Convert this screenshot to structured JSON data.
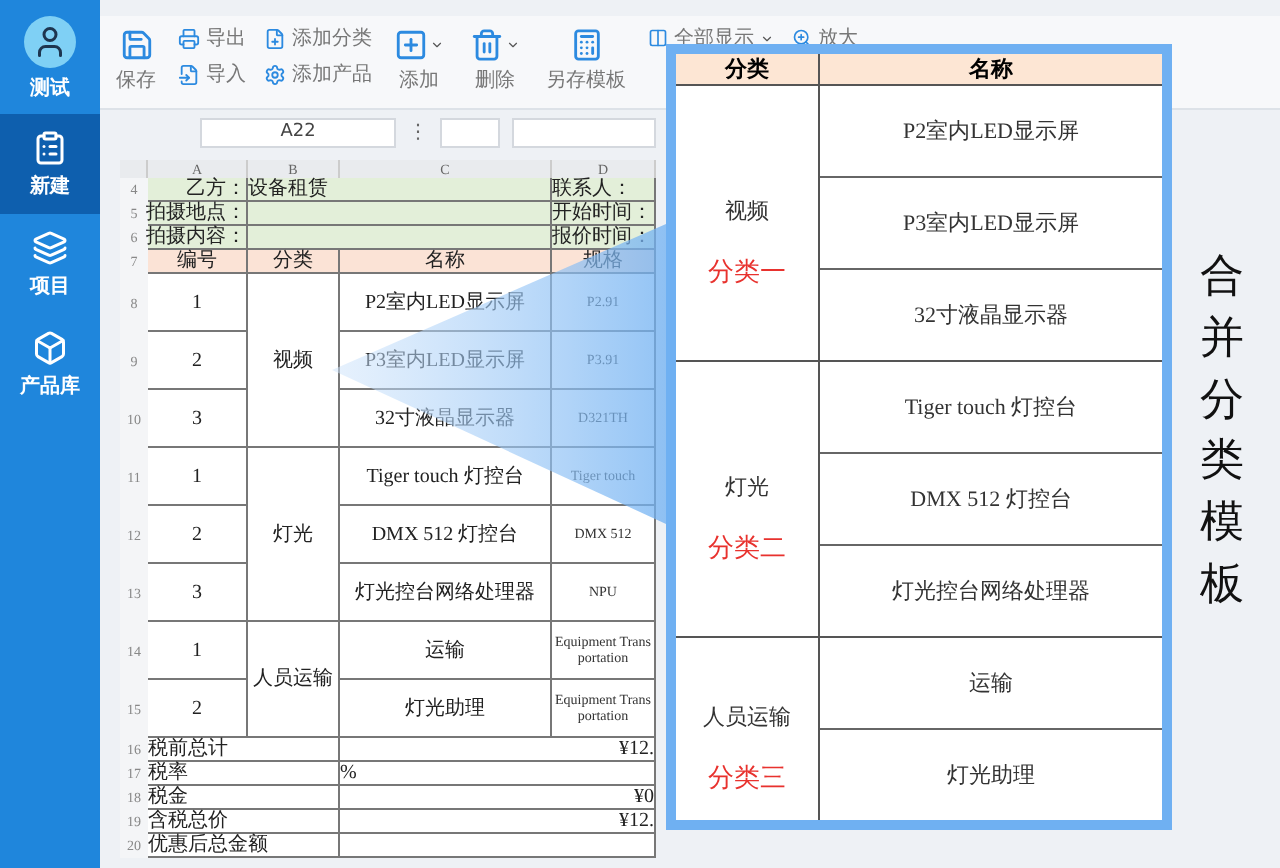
{
  "sidebar": {
    "user": "测试",
    "items": [
      {
        "label": "新建",
        "selected": true
      },
      {
        "label": "项目",
        "selected": false
      },
      {
        "label": "产品库",
        "selected": false
      }
    ]
  },
  "toolbar": [
    {
      "kind": "large",
      "label": "保存"
    },
    {
      "kind": "pair",
      "labels": [
        "导出",
        "导入"
      ]
    },
    {
      "kind": "pair",
      "labels": [
        "添加分类",
        "添加产品"
      ]
    },
    {
      "kind": "dropdown",
      "label": "添加"
    },
    {
      "kind": "dropdown",
      "label": "删除"
    },
    {
      "kind": "large",
      "label": "另存模板"
    },
    {
      "kind": "select",
      "label": "全部显示"
    },
    {
      "kind": "small",
      "label": "放大"
    }
  ],
  "formula_bar": {
    "cell_ref": "A22",
    "separator": "⋮"
  },
  "sheet": {
    "columns": [
      "A",
      "B",
      "C",
      "D"
    ],
    "info_rows": [
      {
        "row": "4",
        "label": "乙方：",
        "value": "设备租赁",
        "label_2": "联系人："
      },
      {
        "row": "5",
        "label": "拍摄地点：",
        "label_2": "开始时间："
      },
      {
        "row": "6",
        "label": "拍摄内容：",
        "label_2": "报价时间："
      }
    ],
    "header": {
      "row": "7",
      "cells": [
        "编号",
        "分类",
        "名称",
        "规格"
      ]
    },
    "groups": [
      {
        "category": "视频",
        "items": [
          {
            "row": "8",
            "no": "1",
            "name": "P2室内LED显示屏",
            "spec": "P2.91"
          },
          {
            "row": "9",
            "no": "2",
            "name": "P3室内LED显示屏",
            "spec": "P3.91"
          },
          {
            "row": "10",
            "no": "3",
            "name": "32寸液晶显示器",
            "spec": "D321TH"
          }
        ]
      },
      {
        "category": "灯光",
        "items": [
          {
            "row": "11",
            "no": "1",
            "name": "Tiger touch 灯控台",
            "spec": "Tiger touch"
          },
          {
            "row": "12",
            "no": "2",
            "name": "DMX 512 灯控台",
            "spec": "DMX 512"
          },
          {
            "row": "13",
            "no": "3",
            "name": "灯光控台网络处理器",
            "spec": "NPU"
          }
        ]
      },
      {
        "category": "人员运输",
        "items": [
          {
            "row": "14",
            "no": "1",
            "name": "运输",
            "spec": "Equipment Transportation"
          },
          {
            "row": "15",
            "no": "2",
            "name": "灯光助理",
            "spec": "Equipment Transportation"
          }
        ]
      }
    ],
    "totals": [
      {
        "row": "16",
        "label": "税前总计",
        "kind": "amount",
        "value": "¥12."
      },
      {
        "row": "17",
        "label": "税率",
        "kind": "percent",
        "value": "%"
      },
      {
        "row": "18",
        "label": "税金",
        "kind": "amount",
        "value": "¥0"
      },
      {
        "row": "19",
        "label": "含税总价",
        "kind": "amount",
        "value": "¥12."
      },
      {
        "row": "20",
        "label": "优惠后总金额",
        "kind": "amount"
      }
    ]
  },
  "overlay": {
    "columns": [
      "分类",
      "名称"
    ],
    "groups": [
      {
        "category": "视频",
        "tag": "分类一",
        "items": [
          "P2室内LED显示屏",
          "P3室内LED显示屏",
          "32寸液晶显示器"
        ]
      },
      {
        "category": "灯光",
        "tag": "分类二",
        "items": [
          "Tiger touch 灯控台",
          "DMX 512 灯控台",
          "灯光控台网络处理器"
        ]
      },
      {
        "category": "人员运输",
        "tag": "分类三",
        "items": [
          "运输",
          "灯光助理"
        ]
      }
    ]
  },
  "caption": "合并分类模板"
}
